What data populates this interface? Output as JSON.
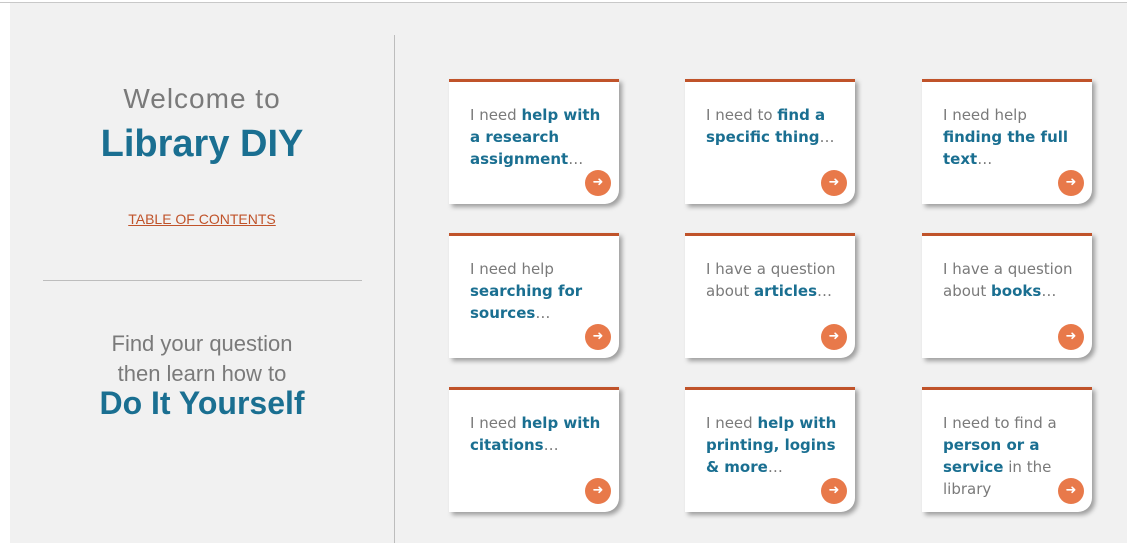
{
  "intro": {
    "welcome": "Welcome to",
    "brand": "Library DIY",
    "toc_link": "TABLE OF CONTENTS",
    "find_line1": "Find your question",
    "find_line2": "then learn how to",
    "diy": "Do It Yourself"
  },
  "cards": [
    {
      "pre": "I need ",
      "bold": "help with a research assignment",
      "post": "…"
    },
    {
      "pre": "I need to ",
      "bold": "find a specific thing",
      "post": "…"
    },
    {
      "pre": "I need help ",
      "bold": "finding the full text",
      "post": "…"
    },
    {
      "pre": "I need help ",
      "bold": "searching for sources",
      "post": "…"
    },
    {
      "pre": "I have a question about ",
      "bold": "articles",
      "post": "…"
    },
    {
      "pre": "I have a question about ",
      "bold": "books",
      "post": "…"
    },
    {
      "pre": "I need ",
      "bold": "help with citations",
      "post": "…"
    },
    {
      "pre": "I need ",
      "bold": "help with printing, logins & more",
      "post": "…"
    },
    {
      "pre": "I need to find a ",
      "bold": "person or a service",
      "post": " in the library"
    }
  ],
  "icons": {
    "card_arrow": "arrow-right-circle-icon"
  },
  "colors": {
    "accent": "#c0532a",
    "brand": "#1a6f91",
    "arrow": "#e8794a",
    "muted": "#7a7a7a"
  }
}
